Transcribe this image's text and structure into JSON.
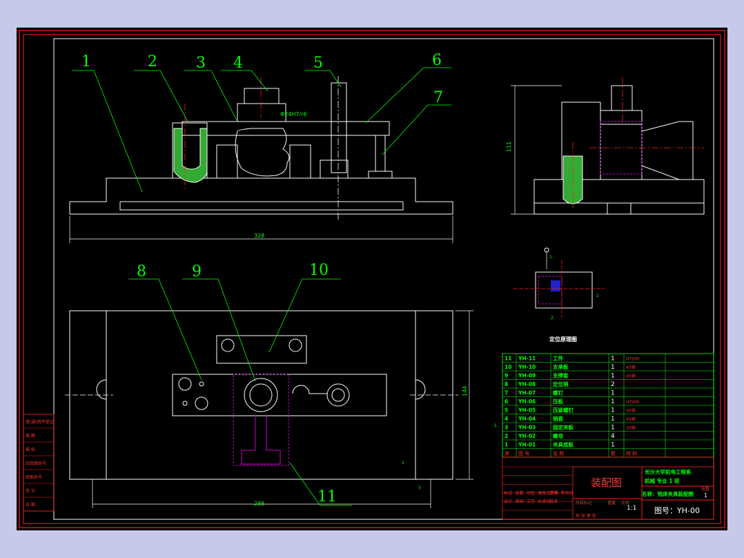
{
  "drawing": {
    "callouts": [
      "1",
      "2",
      "3",
      "4",
      "5",
      "6",
      "7",
      "8",
      "9",
      "10",
      "11"
    ],
    "dims": {
      "front_width": "328",
      "side_height": "111",
      "plan_width": "288",
      "plan_height": "144",
      "fit_label": "Φ24H7/r6",
      "locate_mark_1": "1",
      "locate_mark_2": "2",
      "locate_mark_3": "3"
    },
    "side_mark": "1",
    "plan_marks": [
      "2",
      "3"
    ],
    "locating_caption": "定位原理图"
  },
  "bom": [
    {
      "no": "11",
      "code": "YH-11",
      "name": "工件",
      "qty": "1",
      "mat": "HT200"
    },
    {
      "no": "10",
      "code": "YH-10",
      "name": "支承板",
      "qty": "1",
      "mat": "45钢"
    },
    {
      "no": "9",
      "code": "YH-09",
      "name": "支撑套",
      "qty": "1",
      "mat": "45钢"
    },
    {
      "no": "8",
      "code": "YH-08",
      "name": "定位销",
      "qty": "2",
      "mat": ""
    },
    {
      "no": "7",
      "code": "YH-07",
      "name": "螺钉",
      "qty": "1",
      "mat": ""
    },
    {
      "no": "6",
      "code": "YH-06",
      "name": "压板",
      "qty": "1",
      "mat": "HT200"
    },
    {
      "no": "5",
      "code": "YH-05",
      "name": "压紧螺钉",
      "qty": "1",
      "mat": "45钢"
    },
    {
      "no": "4",
      "code": "YH-04",
      "name": "销套",
      "qty": "1",
      "mat": "45钢"
    },
    {
      "no": "3",
      "code": "YH-03",
      "name": "固定夹板",
      "qty": "1",
      "mat": "20钢"
    },
    {
      "no": "2",
      "code": "YH-02",
      "name": "螺母",
      "qty": "4",
      "mat": ""
    },
    {
      "no": "1",
      "code": "YH-01",
      "name": "夹具底板",
      "qty": "1",
      "mat": ""
    }
  ],
  "bom_header": {
    "no": "序",
    "code": "图  号",
    "name": "名  称",
    "qty": "数",
    "mat": "材  料"
  },
  "title_block": {
    "title": "装配图",
    "school": "长沙大学机电工程系",
    "class_line": "机械 专业 1 班",
    "name_label": "名称：铣床夹具装配图",
    "drawing_no": "图号：YH-00",
    "scale": "1:1",
    "sheet": "1",
    "sheet_label": "张数",
    "labels_left": [
      "标记",
      "处数",
      "分区",
      "更改文件号",
      "签名",
      "年月日",
      "设计",
      "审核",
      "工艺",
      "标准化",
      "批准"
    ],
    "stage_label": "阶段标记",
    "weight_label": "重量",
    "scale_label": "比例",
    "share_label": "共 张 第 张"
  },
  "left_strip": [
    "借(通)用件登记",
    "描  图",
    "描  校",
    "旧底图总号",
    "底图总号",
    "签  字",
    "日  期"
  ]
}
